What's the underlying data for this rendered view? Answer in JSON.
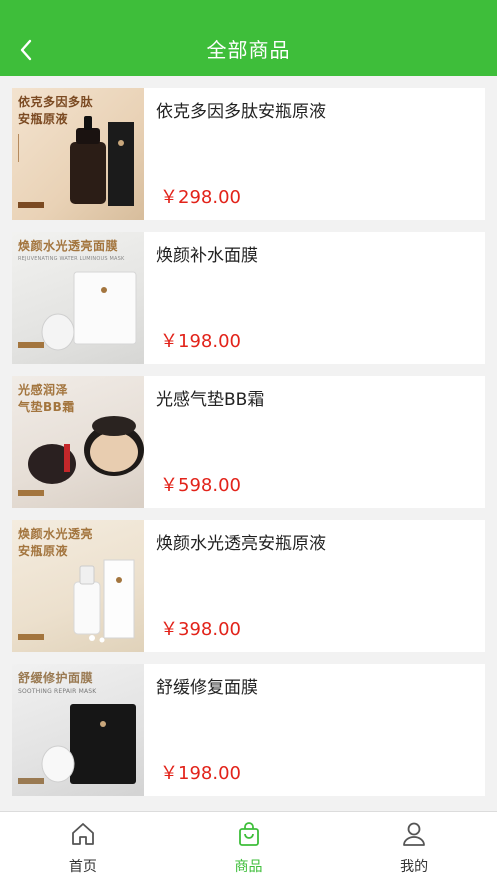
{
  "header": {
    "title": "全部商品",
    "back_icon": "chevron-left-icon",
    "bg_color": "#3ebe3a"
  },
  "products": [
    {
      "name": "依克多因多肽安瓶原液",
      "price": "￥298.00",
      "thumb_title_lines": [
        "依克多因多肽",
        "安瓶原液"
      ],
      "thumb_style": "dark-bottle"
    },
    {
      "name": "焕颜补水面膜",
      "price": "￥198.00",
      "thumb_title_lines": [
        "焕颜水光透亮面膜"
      ],
      "thumb_sub": "REJUVENATING WATER LUMINOUS MASK",
      "thumb_style": "white-mask"
    },
    {
      "name": "光感气垫BB霜",
      "price": "￥598.00",
      "thumb_title_lines": [
        "光感润泽",
        "气垫BB霜"
      ],
      "thumb_style": "cushion"
    },
    {
      "name": "焕颜水光透亮安瓶原液",
      "price": "￥398.00",
      "thumb_title_lines": [
        "焕颜水光透亮",
        "安瓶原液"
      ],
      "thumb_style": "white-bottle"
    },
    {
      "name": "舒缓修复面膜",
      "price": "￥198.00",
      "thumb_title_lines": [
        "舒缓修护面膜"
      ],
      "thumb_sub": "SOOTHING REPAIR MASK",
      "thumb_style": "black-mask"
    }
  ],
  "tabbar": {
    "tabs": [
      {
        "label": "首页",
        "icon": "home-icon",
        "active": false
      },
      {
        "label": "商品",
        "icon": "shopping-bag-icon",
        "active": true
      },
      {
        "label": "我的",
        "icon": "user-icon",
        "active": false
      }
    ]
  },
  "colors": {
    "accent": "#3ebe3a",
    "price": "#e2231a"
  }
}
